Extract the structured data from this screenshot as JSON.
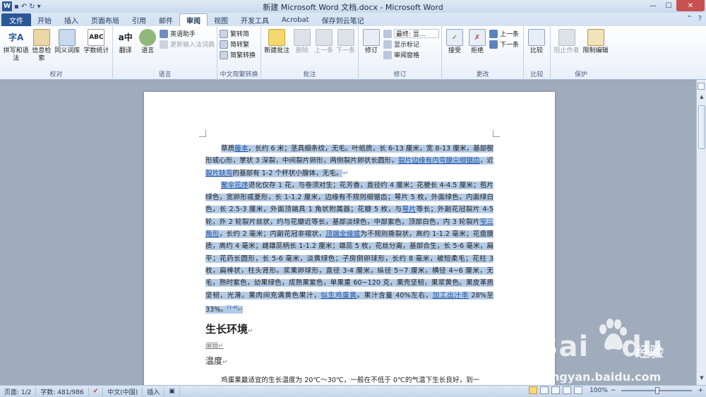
{
  "window": {
    "title": "新建 Microsoft Word 文档.docx - Microsoft Word",
    "controls": {
      "minimize": "—",
      "maximize": "☐",
      "close": "✕"
    }
  },
  "qat": {
    "logo": "W",
    "save": "▪",
    "undo": "↶",
    "redo": "↻",
    "customize": "▾"
  },
  "tabs": [
    {
      "label": "文件"
    },
    {
      "label": "开始"
    },
    {
      "label": "插入"
    },
    {
      "label": "页面布局"
    },
    {
      "label": "引用"
    },
    {
      "label": "邮件"
    },
    {
      "label": "审阅"
    },
    {
      "label": "视图"
    },
    {
      "label": "开发工具"
    },
    {
      "label": "Acrobat"
    },
    {
      "label": "保存到云笔记"
    }
  ],
  "tab_right": {
    "help": "?",
    "expand": "⌃"
  },
  "ribbon": {
    "proofing": {
      "label": "校对",
      "spell": "拼写和语法",
      "research": "信息检索",
      "thesaurus": "同义词库",
      "wordcount": "字数统计"
    },
    "language": {
      "label": "语言",
      "translate": "翻译",
      "language": "语言",
      "english_assistant": "英语助手",
      "update_ime": "更新输入法词典"
    },
    "chinese": {
      "label": "中文简繁转换",
      "to_simplified": "繁转简",
      "to_traditional": "简转繁",
      "convert": "简繁转换"
    },
    "comments": {
      "label": "批注",
      "new": "新建批注",
      "delete": "删除",
      "prev": "上一条",
      "next": "下一条"
    },
    "tracking": {
      "label": "修订",
      "track": "修订",
      "display": "最终: 显...",
      "show_markup": "显示标记",
      "reviewing_pane": "审阅窗格"
    },
    "changes": {
      "label": "更改",
      "accept": "接受",
      "reject": "拒绝",
      "prev": "上一条",
      "next": "下一条"
    },
    "compare": {
      "label": "比较",
      "compare": "比较"
    },
    "protect": {
      "label": "保护",
      "block_authors": "阻止作者",
      "restrict": "限制编辑"
    }
  },
  "document": {
    "para1_pre": "草质",
    "para1_link1": "藤本",
    "para1_mid": "，长约 6 米；茎具细条纹，无毛。叶纸质，长 6-13 厘米，宽 8-13 厘米，基部楔形或心形，掌状 3 深裂，中间裂片卵形，两侧裂片卵状长圆形，",
    "para1_link2": "裂片边缘有内弯腺尖细锯齿",
    "para1_mid2": "，近",
    "para1_link3": "裂片缺弯",
    "para1_end": "的基部有 1-2 个杯状小腺体，无毛。",
    "para2_link": "聚伞花序",
    "para2_a": "退化仅存 1 花，与卷须对生；花芳香，直径约 4 厘米；花梗长 4-4.5 厘米；苞片绿色，宽卵形或菱形，长 1-1.2 厘米，边缘有不规则细锯齿；萼片 5 枚，外面绿色，内面绿白色，长 2.5-3 厘米，外面顶端具 1 角状附属器；花瓣 5 枚，与",
    "para2_link2": "萼片",
    "para2_b": "等长；外副花冠裂片 4-5 轮，外 2 轮裂片丝状，约与花瓣近等长，基部淡绿色，中部紫色，顶部白色，内 3 轮裂片",
    "para2_link3": "窄三角形",
    "para2_c": "，长约 2 毫米；内副花冠非褶状，",
    "para2_link4": "顶端全缘或",
    "para2_d": "为不规则撕裂状，高约 1-1.2 毫米；花盘膜质，高约 4 毫米；雌雄蕊柄长 1-1.2 厘米；雄蕊 5 枚，花丝分离，基部合生，长 5-6 毫米，扁平；花药长圆形，长 5-6 毫米，淡黄绿色；子房倒卵球形，长约 8 毫米，被短柔毛；花柱 3 枚，扁棒状，柱头肾形。浆果卵球形，直径 3-4 厘米，纵径 5~7 厘米，横径 4~6 厘米，无毛，熟时紫色，幼果绿色，成熟果紫色，单果重 60~120 克，果壳坚韧，果浆黄色。果皮革质坚韧，光滑。果肉间充满黄色果汁，",
    "para2_link5": "似生鸡蛋黄",
    "para2_e": "。果汁含量 40%左右，",
    "para2_link6": "加工出汁率",
    "para2_f": " 28%至 33%。",
    "para2_mark": "[1-4]",
    "heading": "生长环境",
    "edit_link": "编辑",
    "subheading": "温度",
    "para3": "鸡蛋果最适宜的生长温度为 20℃～30℃，一般在不低于 0℃的气温下生长良好，到一",
    "pilcrow": "↵"
  },
  "watermark": {
    "brand": "Bai",
    "brand2": "du",
    "cn": "经验",
    "url": "jingyan.baidu.com"
  },
  "status": {
    "page": "页面: 1/2",
    "words": "字数: 481/986",
    "language": "中文(中国)",
    "mode": "插入",
    "zoom": "100%",
    "zoom_level": 1.0,
    "zoom_out": "−",
    "zoom_in": "+"
  },
  "colors": {
    "accent": "#2b5797",
    "selection": "#b4cbe6",
    "link": "#1f55a8"
  }
}
